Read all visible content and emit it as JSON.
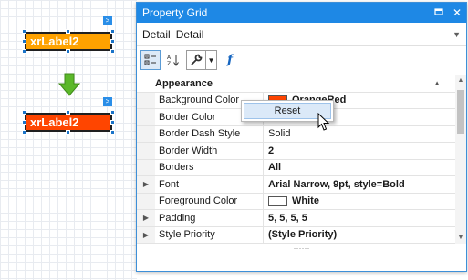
{
  "designer": {
    "label_before": "xrLabel2",
    "label_after": "xrLabel2",
    "colors": {
      "before": "#ffa200",
      "after": "#ff4500",
      "arrow": "#5cb82a"
    }
  },
  "panel": {
    "title": "Property Grid",
    "pin_icon": "pin-icon",
    "close_icon": "close-icon",
    "selector": {
      "type": "Detail",
      "name": "Detail"
    },
    "toolbar": {
      "categorized_icon": "categorized-icon",
      "alphabetical_icon": "alphabetical-icon",
      "properties_icon": "wrench-icon",
      "events_icon": "fx-icon"
    }
  },
  "grid": {
    "category": "Appearance",
    "rows": [
      {
        "name": "Background Color",
        "value": "OrangeRed",
        "swatch": "#ff4500",
        "expandable": false,
        "bold": true
      },
      {
        "name": "Border Color",
        "value": "",
        "expandable": false,
        "bold": false
      },
      {
        "name": "Border Dash Style",
        "value": "Solid",
        "expandable": false,
        "bold": false
      },
      {
        "name": "Border Width",
        "value": "2",
        "expandable": false,
        "bold": true
      },
      {
        "name": "Borders",
        "value": "All",
        "expandable": false,
        "bold": true
      },
      {
        "name": "Font",
        "value": "Arial Narrow, 9pt, style=Bold",
        "expandable": true,
        "bold": true
      },
      {
        "name": "Foreground Color",
        "value": "White",
        "swatch": "#ffffff",
        "expandable": false,
        "bold": true
      },
      {
        "name": "Padding",
        "value": "5, 5, 5, 5",
        "expandable": true,
        "bold": true
      },
      {
        "name": "Style Priority",
        "value": "(Style Priority)",
        "expandable": true,
        "bold": true
      }
    ]
  },
  "context_menu": {
    "reset_label": "Reset"
  },
  "colors": {
    "accent": "#1e88e5"
  }
}
